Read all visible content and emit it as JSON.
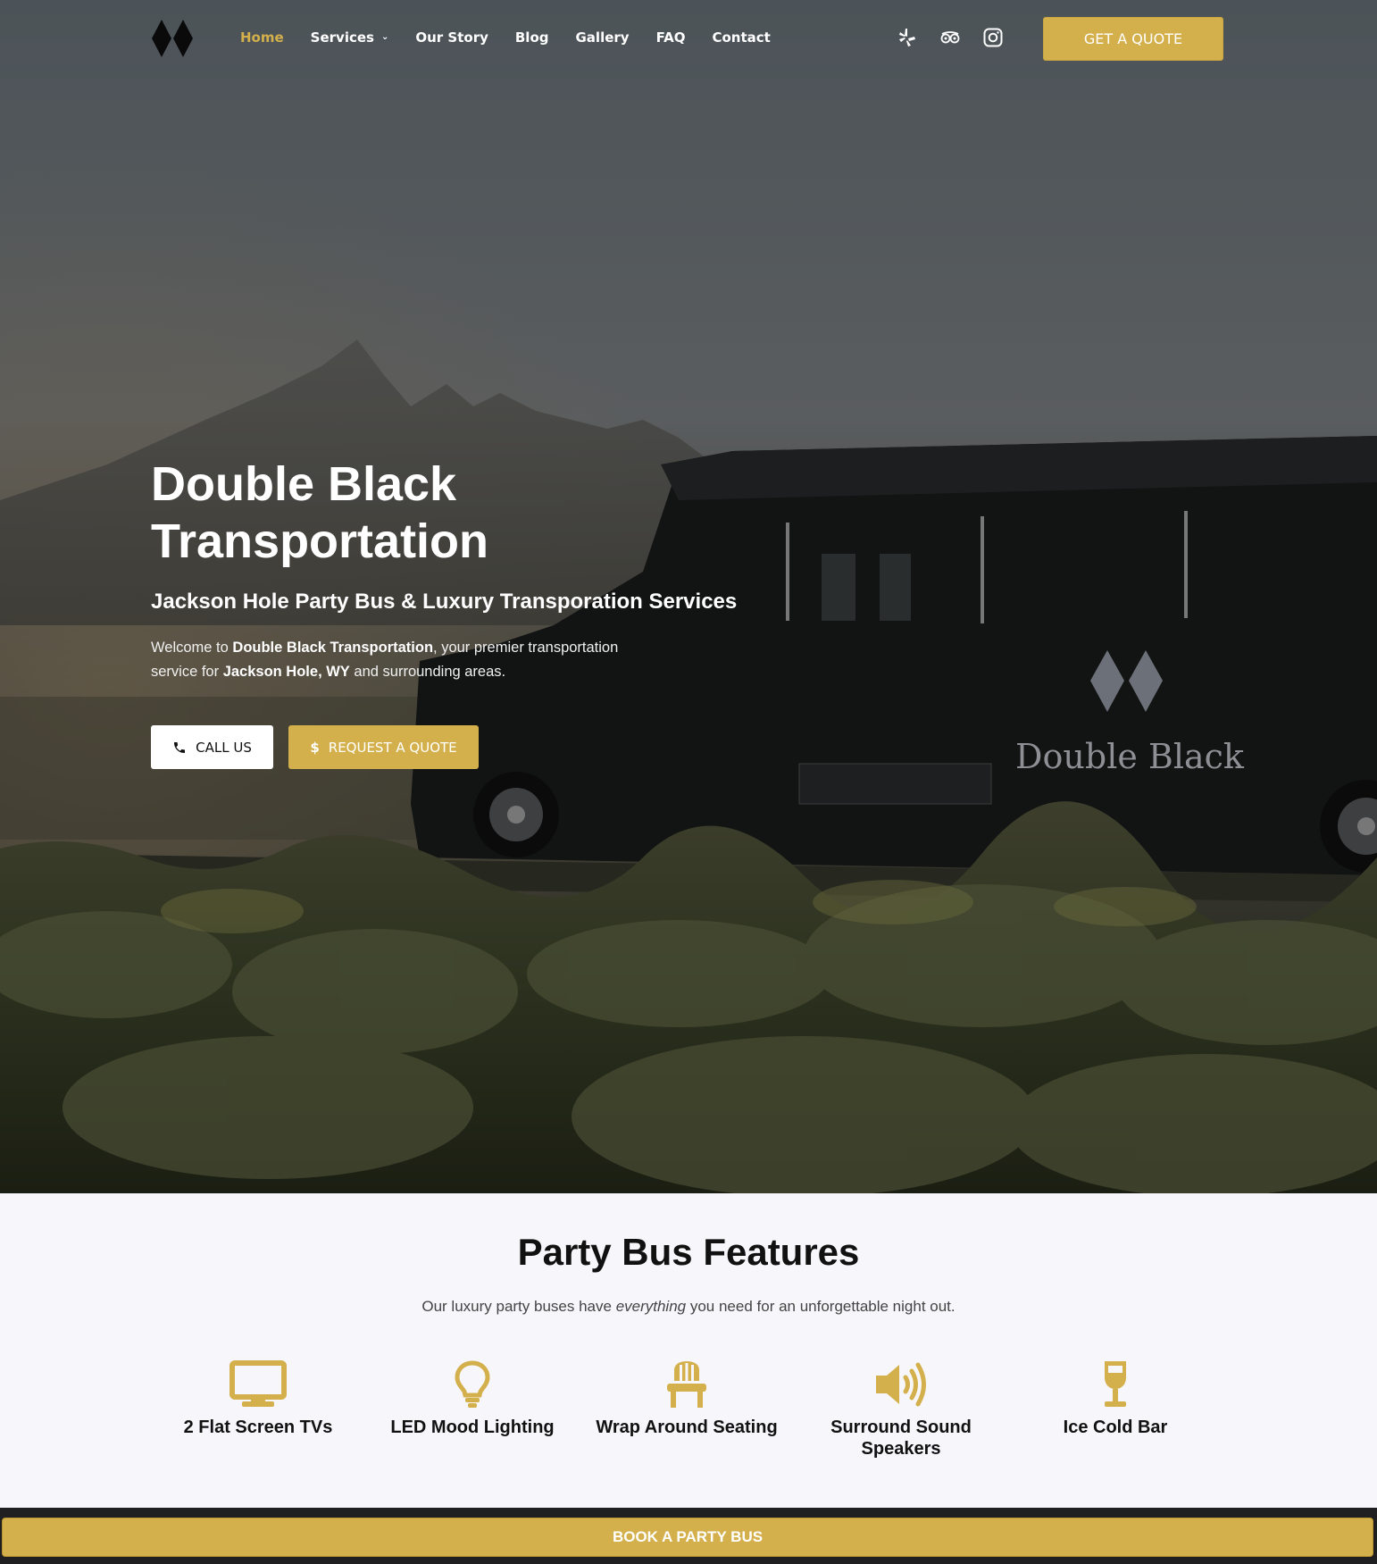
{
  "nav": {
    "items": [
      {
        "label": "Home",
        "active": true
      },
      {
        "label": "Services",
        "has_dropdown": true
      },
      {
        "label": "Our Story"
      },
      {
        "label": "Blog"
      },
      {
        "label": "Gallery"
      },
      {
        "label": "FAQ"
      },
      {
        "label": "Contact"
      }
    ],
    "socials": [
      "yelp-icon",
      "tripadvisor-icon",
      "instagram-icon"
    ],
    "quote_button": "GET A QUOTE"
  },
  "hero": {
    "title": "Double Black Transportation",
    "subtitle": "Jackson Hole Party Bus & Luxury Transporation Services",
    "text_prefix": "Welcome to ",
    "text_brand": "Double Black Transportation",
    "text_mid": ", your premier transportation service for ",
    "text_place": "Jackson Hole, WY",
    "text_suffix": " and surrounding areas.",
    "call_button": "CALL US",
    "request_button": "REQUEST A QUOTE",
    "bus_lettering": "Double Black"
  },
  "features": {
    "title": "Party Bus Features",
    "lead_prefix": "Our luxury party buses have ",
    "lead_em": "everything",
    "lead_suffix": " you need for an unforgettable night out.",
    "items": [
      {
        "label": "2 Flat Screen TVs",
        "icon": "tv-icon"
      },
      {
        "label": "LED Mood Lighting",
        "icon": "lightbulb-icon"
      },
      {
        "label": "Wrap Around Seating",
        "icon": "chair-icon"
      },
      {
        "label": "Surround Sound Speakers",
        "icon": "speaker-icon"
      },
      {
        "label": "Ice Cold Bar",
        "icon": "wine-glass-icon"
      }
    ]
  },
  "book_button": "BOOK A PARTY BUS",
  "colors": {
    "accent": "#d4b04c",
    "dark": "#1f1f22"
  }
}
